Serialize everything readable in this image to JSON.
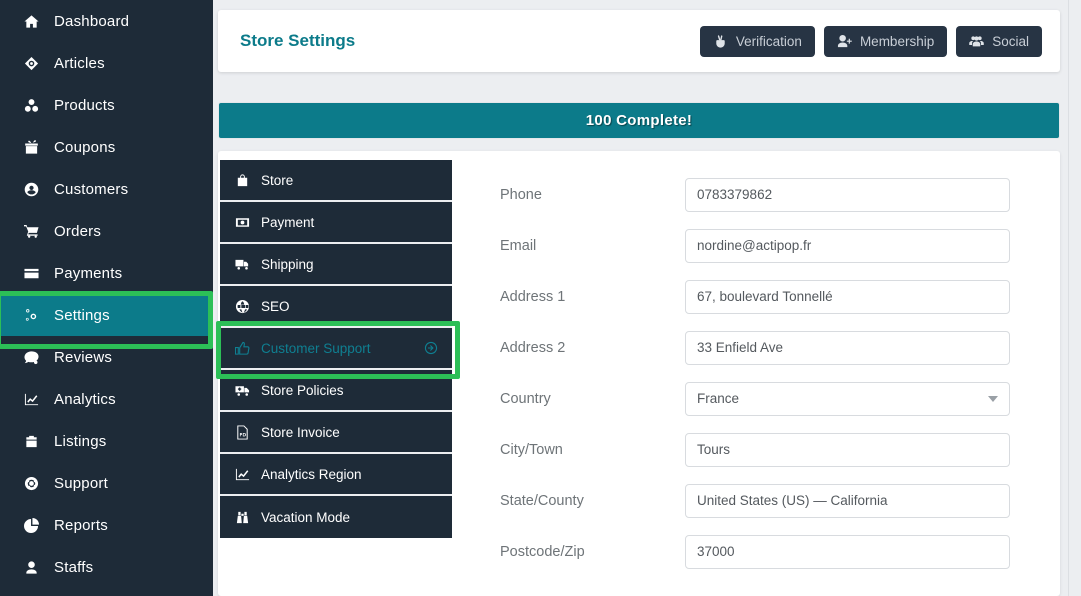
{
  "sidebar": {
    "items": [
      {
        "label": "Dashboard",
        "icon": "home-icon",
        "active": false
      },
      {
        "label": "Articles",
        "icon": "articles-icon",
        "active": false
      },
      {
        "label": "Products",
        "icon": "products-icon",
        "active": false
      },
      {
        "label": "Coupons",
        "icon": "gift-icon",
        "active": false
      },
      {
        "label": "Customers",
        "icon": "user-circle-icon",
        "active": false
      },
      {
        "label": "Orders",
        "icon": "cart-icon",
        "active": false
      },
      {
        "label": "Payments",
        "icon": "credit-card-icon",
        "active": false
      },
      {
        "label": "Settings",
        "icon": "gears-icon",
        "active": true
      },
      {
        "label": "Reviews",
        "icon": "comments-icon",
        "active": false
      },
      {
        "label": "Analytics",
        "icon": "chart-line-icon",
        "active": false
      },
      {
        "label": "Listings",
        "icon": "briefcase-icon",
        "active": false
      },
      {
        "label": "Support",
        "icon": "lifering-icon",
        "active": false
      },
      {
        "label": "Reports",
        "icon": "pie-chart-icon",
        "active": false
      },
      {
        "label": "Staffs",
        "icon": "user-icon",
        "active": false
      }
    ]
  },
  "header": {
    "title": "Store Settings",
    "title_color": "#0c7b8a",
    "buttons": [
      {
        "label": "Verification",
        "icon": "hand-peace-icon"
      },
      {
        "label": "Membership",
        "icon": "user-plus-icon"
      },
      {
        "label": "Social",
        "icon": "users-group-icon"
      }
    ]
  },
  "progress": {
    "label": "100 Complete!",
    "percent": 100,
    "color": "#0c7b8a"
  },
  "tabs": {
    "items": [
      {
        "label": "Store",
        "icon": "shopping-bag-icon",
        "selected": false
      },
      {
        "label": "Payment",
        "icon": "money-bill-icon",
        "selected": false
      },
      {
        "label": "Shipping",
        "icon": "truck-icon",
        "selected": false
      },
      {
        "label": "SEO",
        "icon": "globe-icon",
        "selected": false
      },
      {
        "label": "Customer Support",
        "icon": "thumbs-up-icon",
        "selected": true,
        "trailing_icon": "arrow-circle-right-icon"
      },
      {
        "label": "Store Policies",
        "icon": "ambulance-icon",
        "selected": false
      },
      {
        "label": "Store Invoice",
        "icon": "file-pdf-icon",
        "selected": false
      },
      {
        "label": "Analytics Region",
        "icon": "chart-line-icon",
        "selected": false
      },
      {
        "label": "Vacation Mode",
        "icon": "binoculars-icon",
        "selected": false
      }
    ],
    "selected_color": "#0f7f91"
  },
  "form": {
    "fields": [
      {
        "label": "Phone",
        "value": "0783379862",
        "type": "text"
      },
      {
        "label": "Email",
        "value": "nordine@actipop.fr",
        "type": "text"
      },
      {
        "label": "Address 1",
        "value": "67, boulevard Tonnellé",
        "type": "text"
      },
      {
        "label": "Address 2",
        "value": "33 Enfield Ave",
        "type": "text"
      },
      {
        "label": "Country",
        "value": "France",
        "type": "select"
      },
      {
        "label": "City/Town",
        "value": "Tours",
        "type": "text"
      },
      {
        "label": "State/County",
        "value": "United States (US) — California",
        "type": "text"
      },
      {
        "label": "Postcode/Zip",
        "value": "37000",
        "type": "text"
      }
    ]
  },
  "annotations": {
    "highlight_color": "#2cbf57",
    "boxes": [
      {
        "target": "sidebar-item-settings"
      },
      {
        "target": "tab-customer-support"
      }
    ]
  }
}
